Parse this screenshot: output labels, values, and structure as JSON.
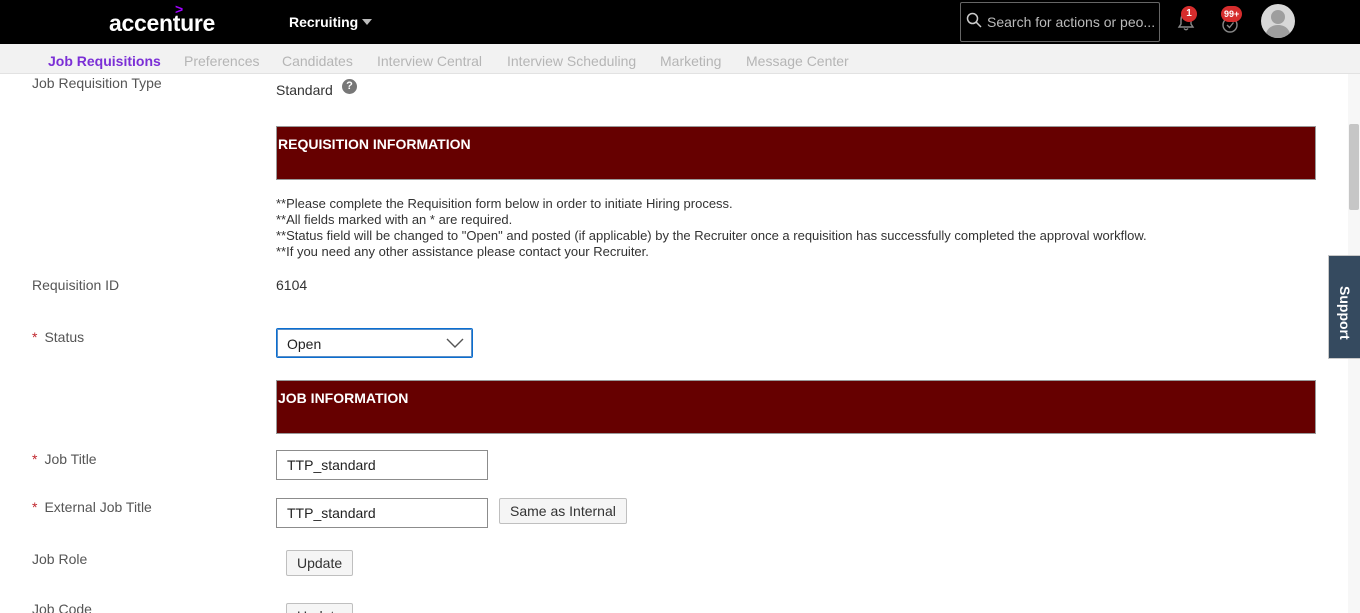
{
  "header": {
    "logo_text": "accenture",
    "logo_mark": ">",
    "module": "Recruiting",
    "search": {
      "placeholder": "Search for actions or peo..."
    },
    "notifications_count": "1",
    "todo_count": "99+"
  },
  "tabs": [
    {
      "label": "Job Requisitions",
      "active": true
    },
    {
      "label": "Preferences"
    },
    {
      "label": "Candidates"
    },
    {
      "label": "Interview Central"
    },
    {
      "label": "Interview Scheduling"
    },
    {
      "label": "Marketing"
    },
    {
      "label": "Message Center"
    }
  ],
  "form": {
    "job_requisition_type": {
      "label": "Job Requisition Type",
      "value": "Standard",
      "help_icon": "?"
    },
    "requisition_section": {
      "title": "REQUISITION INFORMATION"
    },
    "instructions": [
      "**Please complete the Requisition form below in order to initiate Hiring process.",
      "**All fields marked with an * are required.",
      "**Status field will be changed to \"Open\" and posted (if applicable) by the Recruiter once a requisition has successfully completed the approval workflow.",
      "**If you need any other assistance please contact your Recruiter."
    ],
    "requisition_id": {
      "label": "Requisition ID",
      "value": "6104"
    },
    "status": {
      "required_mark": "*",
      "label": "Status",
      "value": "Open"
    },
    "job_section": {
      "title": "JOB INFORMATION"
    },
    "job_title": {
      "required_mark": "*",
      "label": "Job Title",
      "value": "TTP_standard"
    },
    "external_job_title": {
      "required_mark": "*",
      "label": "External Job Title",
      "value": "TTP_standard",
      "button": "Same as Internal"
    },
    "job_role": {
      "label": "Job Role",
      "button": "Update"
    },
    "job_code": {
      "label": "Job Code",
      "button": "Update"
    }
  },
  "support": {
    "label": "Support"
  },
  "colors": {
    "header_bg": "#000000",
    "active_tab": "#7b2fd6",
    "section_bg": "#660000",
    "brand_mark": "#a100ff",
    "badge": "#d62d2d"
  }
}
